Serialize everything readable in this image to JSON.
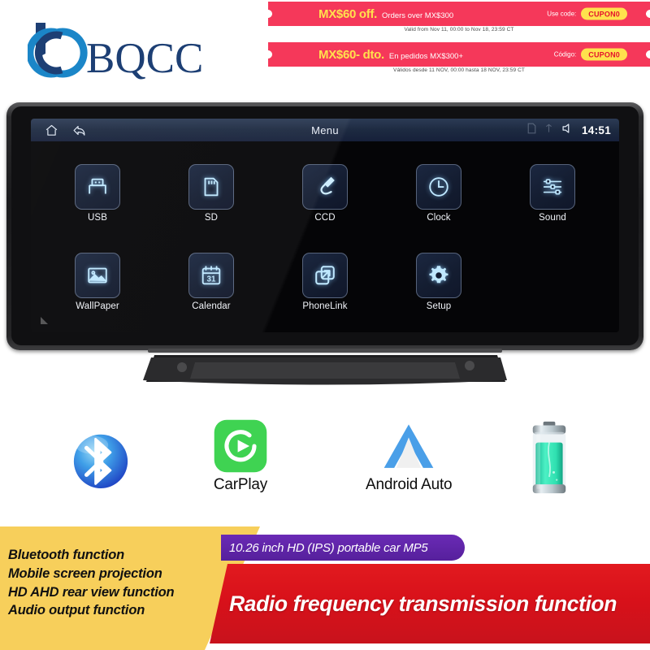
{
  "promos": [
    {
      "amount": "MX$60 off.",
      "subtitle": "Orders over MX$300",
      "code_label": "Use code:",
      "code": "CUPON0",
      "validity": "Valid from Nov 11, 00:00 to Nov 18, 23:59 CT"
    },
    {
      "amount": "MX$60- dto.",
      "subtitle": "En pedidos MX$300+",
      "code_label": "Código:",
      "code": "CUPON0",
      "validity": "Válidos desde 11 NOV, 00:00 hasta 18 NOV, 23:59 CT"
    }
  ],
  "brand": {
    "name": "BQCC"
  },
  "device": {
    "statusbar": {
      "title": "Menu",
      "time": "14:51",
      "home_icon": "home-icon",
      "back_icon": "back-arrow-icon",
      "sim_icon": "sim-card-icon",
      "signal_icon": "signal-icon",
      "mute_icon": "speaker-mute-icon"
    },
    "apps": [
      {
        "label": "USB",
        "icon": "usb-icon"
      },
      {
        "label": "SD",
        "icon": "sd-card-icon"
      },
      {
        "label": "CCD",
        "icon": "camera-plug-icon"
      },
      {
        "label": "Clock",
        "icon": "clock-icon"
      },
      {
        "label": "Sound",
        "icon": "equalizer-sliders-icon"
      },
      {
        "label": "WallPaper",
        "icon": "picture-icon"
      },
      {
        "label": "Calendar",
        "icon": "calendar-icon",
        "day": "31"
      },
      {
        "label": "PhoneLink",
        "icon": "screen-mirror-icon"
      },
      {
        "label": "Setup",
        "icon": "gear-icon"
      }
    ]
  },
  "features": [
    {
      "name": "",
      "icon": "bluetooth-icon"
    },
    {
      "name": "CarPlay",
      "icon": "carplay-icon"
    },
    {
      "name": "Android Auto",
      "icon": "android-auto-icon"
    },
    {
      "name": "",
      "icon": "battery-icon"
    }
  ],
  "bottom": {
    "bullets": "Bluetooth function\nMobile screen projection\nHD AHD rear view function\nAudio output function",
    "purple_banner": "10.26 inch HD (IPS) portable car MP5",
    "red_banner": "Radio frequency transmission function"
  },
  "colors": {
    "promo_bg": "#f5385a",
    "promo_accent": "#ffe14d",
    "brand_blue": "#1d3f74",
    "yellow": "#f7cf5b",
    "purple": "#56209c",
    "red": "#d8111a",
    "carplay_green": "#3fd352",
    "android_blue": "#4a9fe8",
    "battery_green": "#2fe0b0"
  }
}
